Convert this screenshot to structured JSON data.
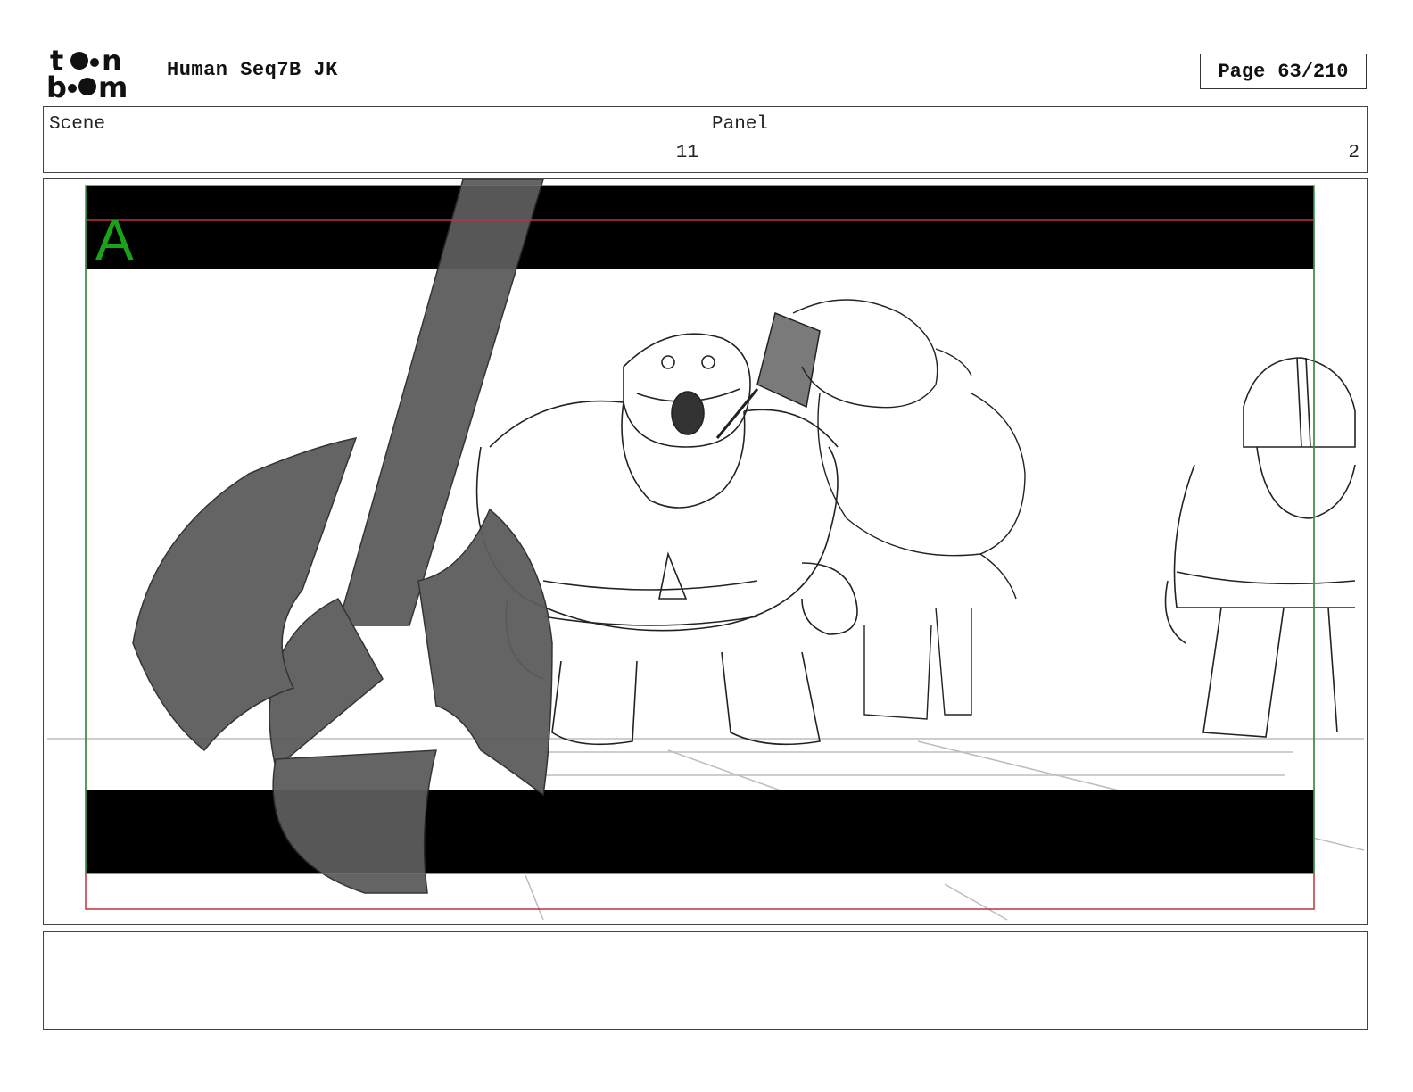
{
  "header": {
    "logo_text": "toon boom",
    "title": "Human Seq7B JK",
    "page_label": "Page",
    "page_number": "63/210"
  },
  "info": {
    "scene_label": "Scene",
    "scene_value": "11",
    "panel_label": "Panel",
    "panel_value": "2"
  },
  "frame": {
    "camera_label": "A",
    "colors": {
      "camera_label": "#1aa31a",
      "safe_frame": "#2f9a4a",
      "field_frame": "#c0323a",
      "letterbox": "#000000",
      "axe": "#5c5c5c"
    }
  },
  "notes": {
    "text": ""
  }
}
